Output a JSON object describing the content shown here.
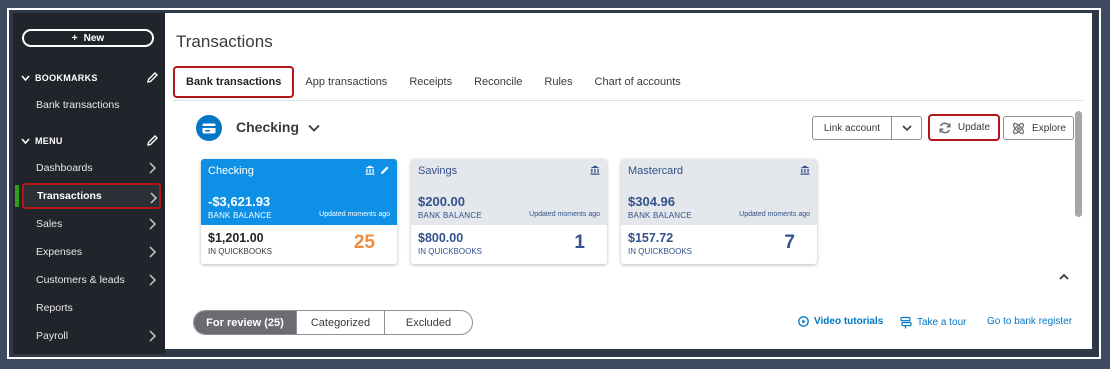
{
  "sidebar": {
    "new_label": "New",
    "bookmarks_label": "BOOKMARKS",
    "bookmark_items": [
      "Bank transactions"
    ],
    "menu_label": "MENU",
    "menu_items": [
      {
        "label": "Dashboards"
      },
      {
        "label": "Transactions"
      },
      {
        "label": "Sales"
      },
      {
        "label": "Expenses"
      },
      {
        "label": "Customers & leads"
      },
      {
        "label": "Reports"
      },
      {
        "label": "Payroll"
      }
    ]
  },
  "page": {
    "title": "Transactions",
    "tabs": [
      "Bank transactions",
      "App transactions",
      "Receipts",
      "Reconcile",
      "Rules",
      "Chart of accounts"
    ]
  },
  "account": {
    "selected": "Checking",
    "link_account_label": "Link account",
    "update_label": "Update",
    "explore_label": "Explore"
  },
  "cards": [
    {
      "name": "Checking",
      "bank_balance": "-$3,621.93",
      "bank_balance_label": "BANK BALANCE",
      "updated": "Updated moments ago",
      "qb_balance": "$1,201.00",
      "qb_label": "IN QUICKBOOKS",
      "count": "25"
    },
    {
      "name": "Savings",
      "bank_balance": "$200.00",
      "bank_balance_label": "BANK BALANCE",
      "updated": "Updated moments ago",
      "qb_balance": "$800.00",
      "qb_label": "IN QUICKBOOKS",
      "count": "1"
    },
    {
      "name": "Mastercard",
      "bank_balance": "$304.96",
      "bank_balance_label": "BANK BALANCE",
      "updated": "Updated moments ago",
      "qb_balance": "$157.72",
      "qb_label": "IN QUICKBOOKS",
      "count": "7"
    }
  ],
  "review_tabs": [
    "For review (25)",
    "Categorized",
    "Excluded"
  ],
  "links": {
    "video_tutorials": "Video tutorials",
    "take_a_tour": "Take a tour",
    "go_to_register": "Go to bank register"
  },
  "colors": {
    "sidebar_bg": "#21242a",
    "highlight_red": "#b2161a",
    "active_green": "#2ca01c",
    "selected_card_blue": "#0d90e6",
    "link_blue": "#0077c5",
    "count_orange": "#f18b3c"
  }
}
